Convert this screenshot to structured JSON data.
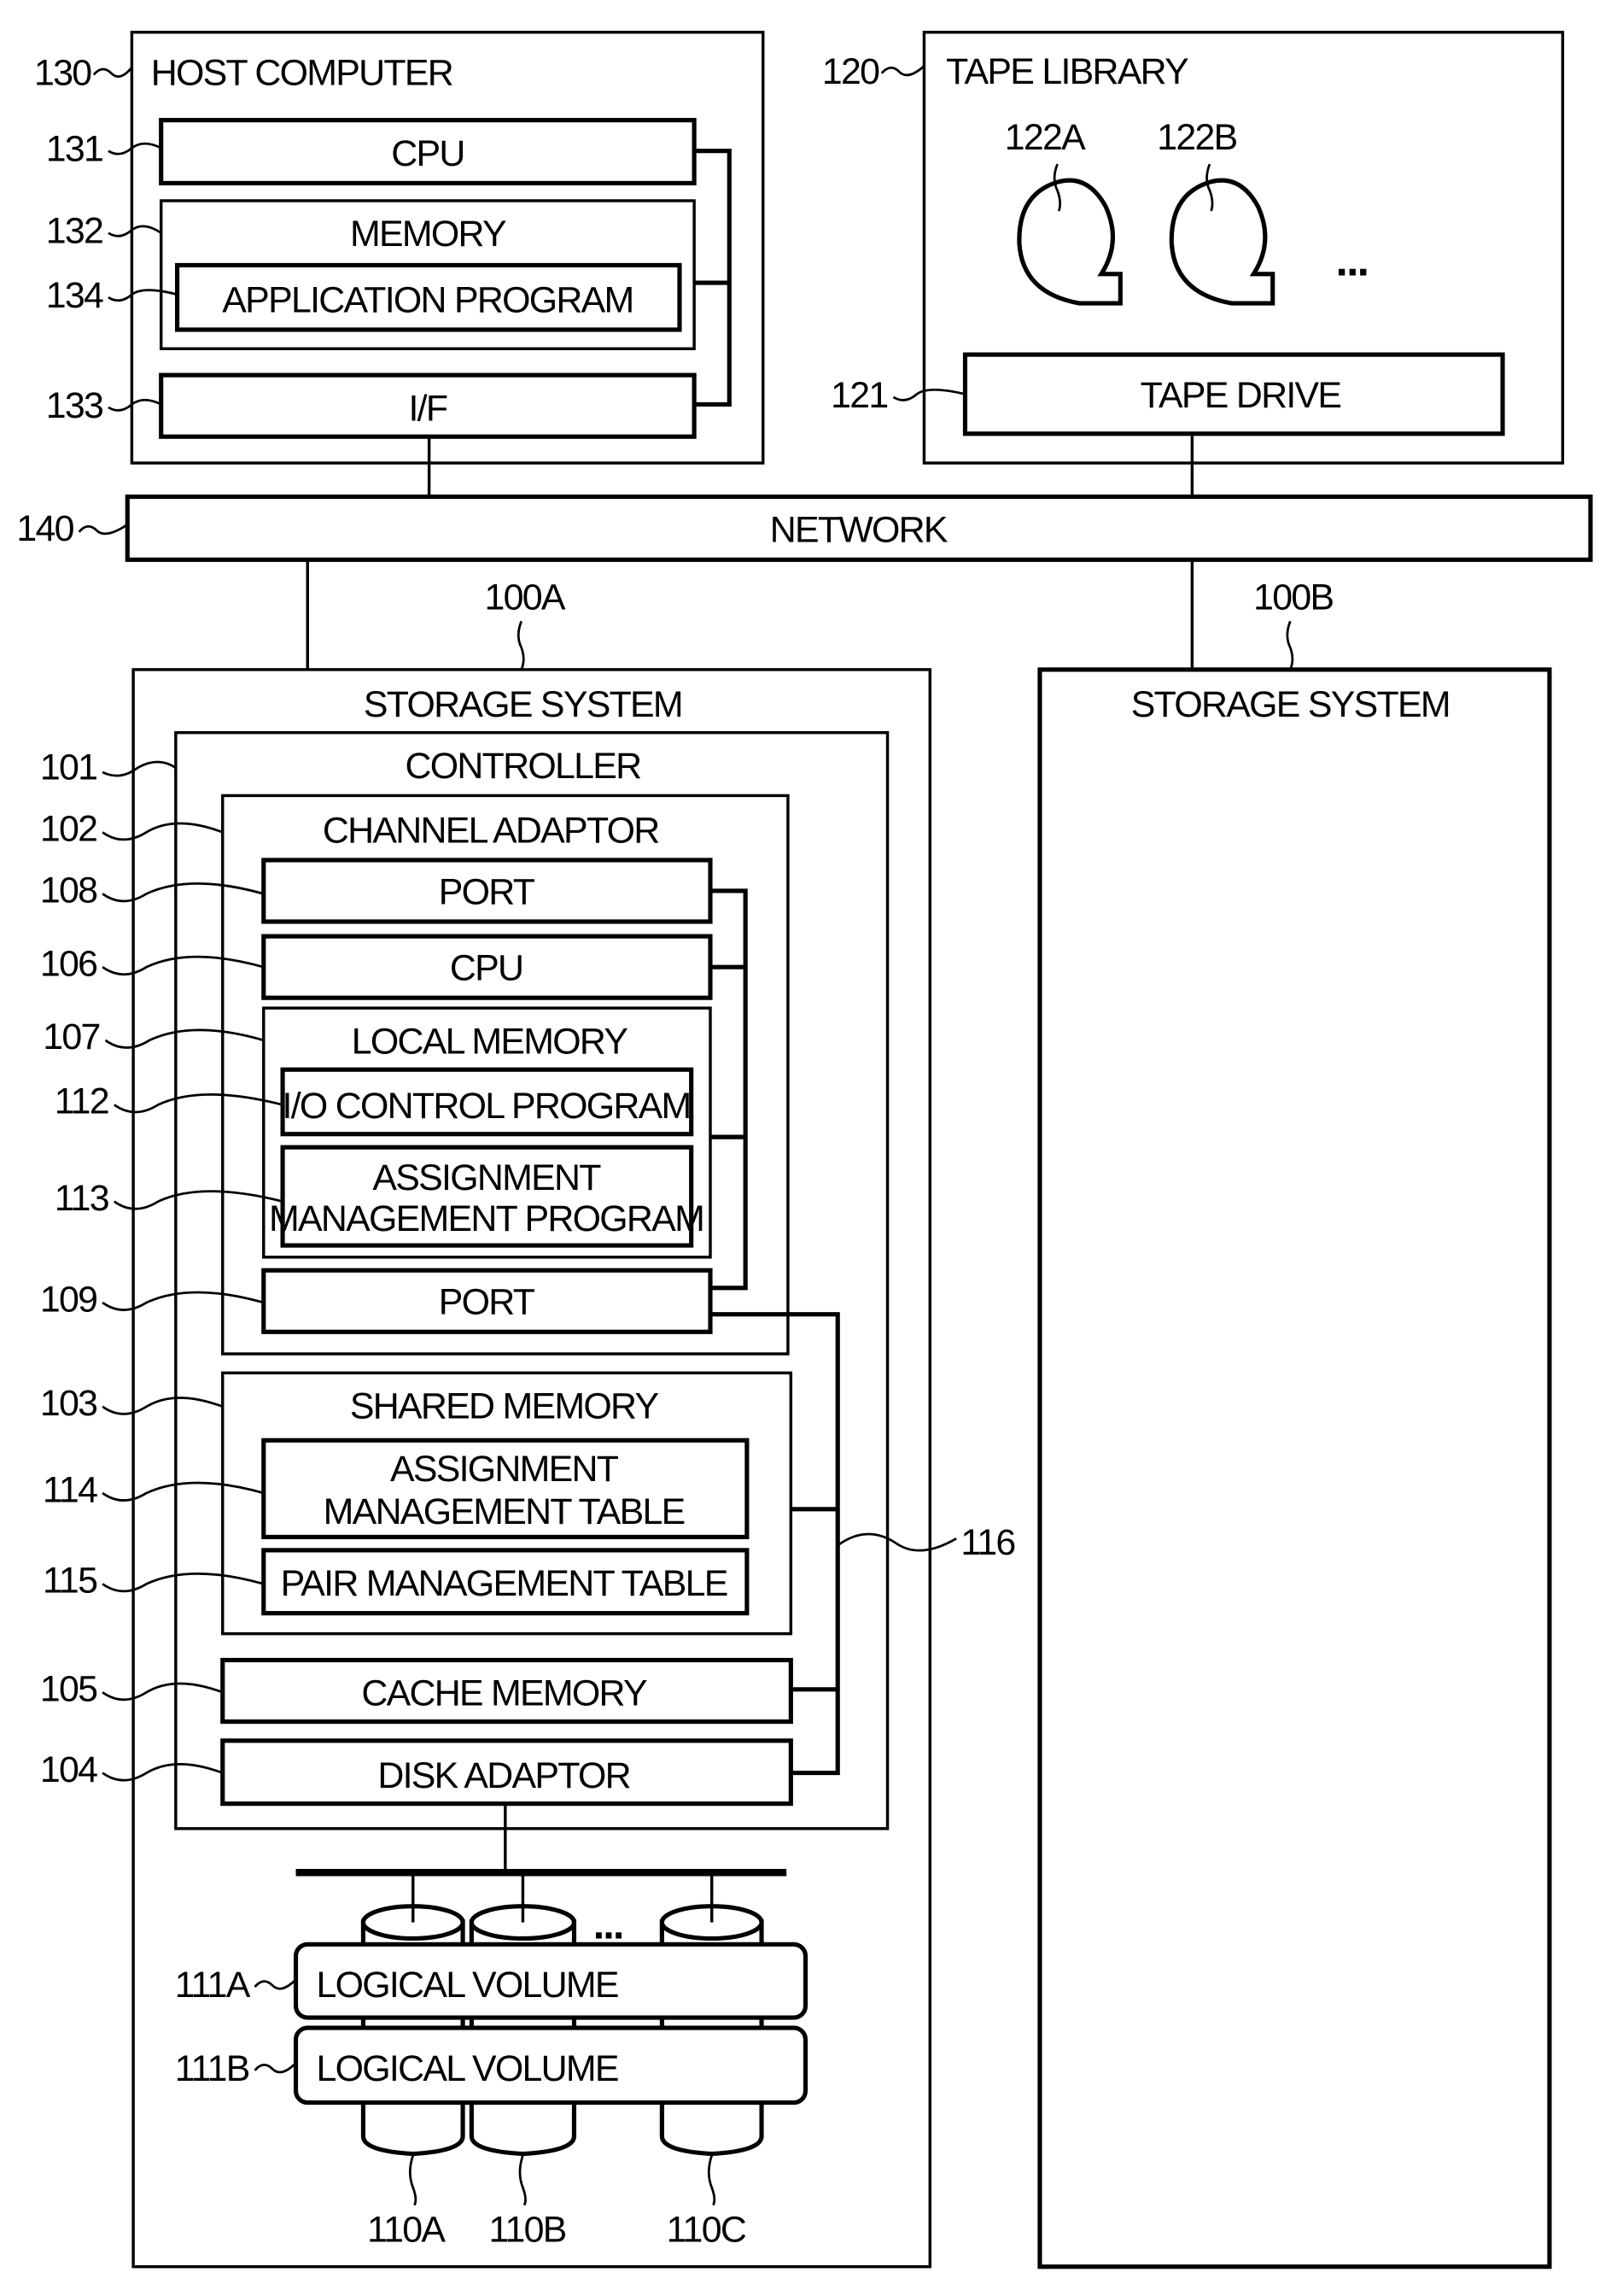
{
  "figure": {
    "host_computer": {
      "ref": "130",
      "title": "HOST COMPUTER",
      "cpu": {
        "ref": "131",
        "label": "CPU"
      },
      "memory": {
        "ref": "132",
        "label": "MEMORY"
      },
      "application_program": {
        "ref": "134",
        "label": "APPLICATION PROGRAM"
      },
      "interface": {
        "ref": "133",
        "label": "I/F"
      }
    },
    "tape_library": {
      "ref": "120",
      "title": "TAPE LIBRARY",
      "tapes": [
        {
          "ref": "122A"
        },
        {
          "ref": "122B"
        }
      ],
      "ellipsis": "...",
      "tape_drive": {
        "ref": "121",
        "label": "TAPE DRIVE"
      }
    },
    "network": {
      "ref": "140",
      "label": "NETWORK"
    },
    "storage_system_a": {
      "ref": "100A",
      "title": "STORAGE SYSTEM",
      "controller": {
        "ref": "101",
        "label": "CONTROLLER"
      },
      "channel_adaptor": {
        "ref": "102",
        "label": "CHANNEL ADAPTOR",
        "port_top": {
          "ref": "108",
          "label": "PORT"
        },
        "cpu": {
          "ref": "106",
          "label": "CPU"
        },
        "local_memory": {
          "ref": "107",
          "label": "LOCAL MEMORY"
        },
        "io_control_program": {
          "ref": "112",
          "label": "I/O CONTROL PROGRAM"
        },
        "assignment_management_program": {
          "ref": "113",
          "line1": "ASSIGNMENT",
          "line2": "MANAGEMENT PROGRAM"
        },
        "port_bottom": {
          "ref": "109",
          "label": "PORT"
        }
      },
      "shared_memory": {
        "ref": "103",
        "label": "SHARED MEMORY",
        "assignment_management_table": {
          "ref": "114",
          "line1": "ASSIGNMENT",
          "line2": "MANAGEMENT TABLE"
        },
        "pair_management_table": {
          "ref": "115",
          "label": "PAIR MANAGEMENT TABLE"
        }
      },
      "internal_bus": {
        "ref": "116"
      },
      "cache_memory": {
        "ref": "105",
        "label": "CACHE MEMORY"
      },
      "disk_adaptor": {
        "ref": "104",
        "label": "DISK ADAPTOR"
      },
      "disk_ellipsis": "...",
      "logical_volumes": [
        {
          "ref": "111A",
          "label": "LOGICAL VOLUME"
        },
        {
          "ref": "111B",
          "label": "LOGICAL VOLUME"
        }
      ],
      "disks": [
        {
          "ref": "110A"
        },
        {
          "ref": "110B"
        },
        {
          "ref": "110C"
        }
      ]
    },
    "storage_system_b": {
      "ref": "100B",
      "title": "STORAGE SYSTEM"
    }
  }
}
